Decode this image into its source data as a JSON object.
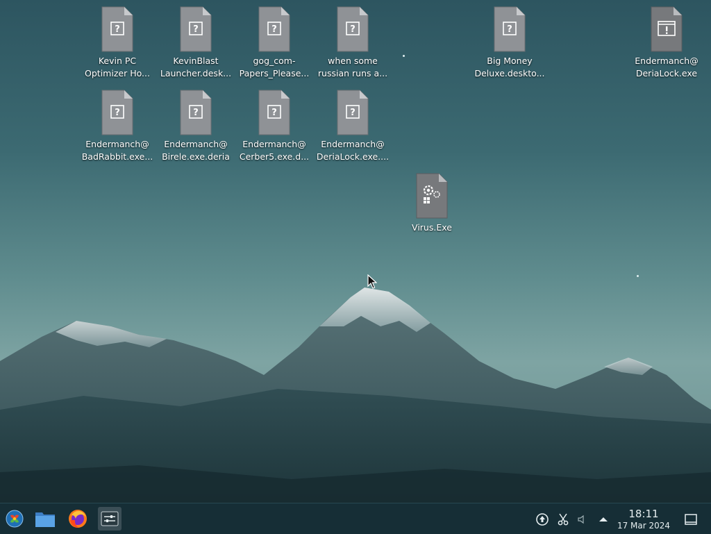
{
  "desktop_icons": [
    {
      "label": "Kevin PC\nOptimizer Ho...",
      "icon": "unknown-file-icon"
    },
    {
      "label": "KevinBlast\nLauncher.desk...",
      "icon": "unknown-file-icon"
    },
    {
      "label": "gog_com-\nPapers_Please...",
      "icon": "unknown-file-icon"
    },
    {
      "label": "when some\nrussian runs a...",
      "icon": "unknown-file-icon"
    },
    {
      "label": "Big Money\nDeluxe.deskto...",
      "icon": "unknown-file-icon"
    },
    {
      "label": "Endermanch@\nDeriaLock.exe",
      "icon": "executable-warning-icon"
    },
    {
      "label": "Endermanch@\nBadRabbit.exe...",
      "icon": "unknown-file-icon"
    },
    {
      "label": "Endermanch@\nBirele.exe.deria",
      "icon": "unknown-file-icon"
    },
    {
      "label": "Endermanch@\nCerber5.exe.d...",
      "icon": "unknown-file-icon"
    },
    {
      "label": "Endermanch@\nDeriaLock.exe....",
      "icon": "unknown-file-icon"
    },
    {
      "label": "Virus.Exe",
      "icon": "executable-gear-icon"
    }
  ],
  "taskbar": {
    "launchers": [
      {
        "name": "application-menu",
        "icon": "kde-start-icon"
      },
      {
        "name": "file-manager",
        "icon": "folder-icon"
      },
      {
        "name": "firefox",
        "icon": "firefox-icon"
      },
      {
        "name": "system-settings",
        "icon": "settings-sliders-icon"
      }
    ],
    "tray": {
      "icons": [
        "updates-icon",
        "clipboard-scissors-icon",
        "volume-icon",
        "expand-tray-arrow-icon"
      ],
      "time": "18:11",
      "date": "17 Mar 2024",
      "show_desktop_icon": "show-desktop-icon"
    }
  },
  "colors": {
    "taskbar_bg": "#162e36",
    "icon_file_fill": "#8f9296",
    "label_text": "#ffffff"
  }
}
